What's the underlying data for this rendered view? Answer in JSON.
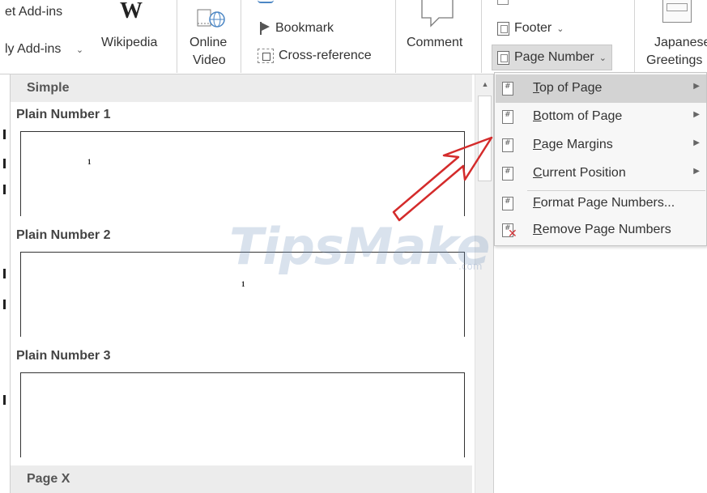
{
  "ribbon": {
    "get_addins_label": "et Add-ins",
    "my_addins_label": "ly Add-ins",
    "wikipedia_label": "Wikipedia",
    "online_video_label_1": "Online",
    "online_video_label_2": "Video",
    "bookmark_label": "Bookmark",
    "cross_reference_label": "Cross-reference",
    "comment_label": "Comment",
    "footer_label": "Footer",
    "page_number_label": "Page Number",
    "japanese_label_1": "Japanese",
    "japanese_label_2": "Greetings",
    "caret": "⌄"
  },
  "gallery": {
    "section_simple": "Simple",
    "section_page_x": "Page X",
    "items": [
      {
        "title": "Plain Number 1",
        "mark": "1"
      },
      {
        "title": "Plain Number 2",
        "mark": "1"
      },
      {
        "title": "Plain Number 3",
        "mark": ""
      }
    ],
    "scroll_up_glyph": "▲"
  },
  "menu": {
    "items": [
      {
        "accel": "T",
        "rest": "op of Page",
        "submenu": true
      },
      {
        "accel": "B",
        "rest": "ottom of Page",
        "submenu": true
      },
      {
        "accel": "P",
        "rest": "age Margins",
        "submenu": true
      },
      {
        "accel": "C",
        "rest": "urrent Position",
        "submenu": true
      },
      {
        "accel": "F",
        "rest": "ormat Page Numbers...",
        "submenu": false
      },
      {
        "accel": "R",
        "rest": "emove Page Numbers",
        "submenu": false
      }
    ],
    "submenu_glyph": "▶"
  },
  "watermark": {
    "brand": "TipsMake",
    "suffix": ".com"
  },
  "colors": {
    "active_item": "#d3d3d3",
    "menu_bg": "#f7f7f7",
    "arrow": "#d42b2b",
    "remove_icon": "#d13438"
  }
}
